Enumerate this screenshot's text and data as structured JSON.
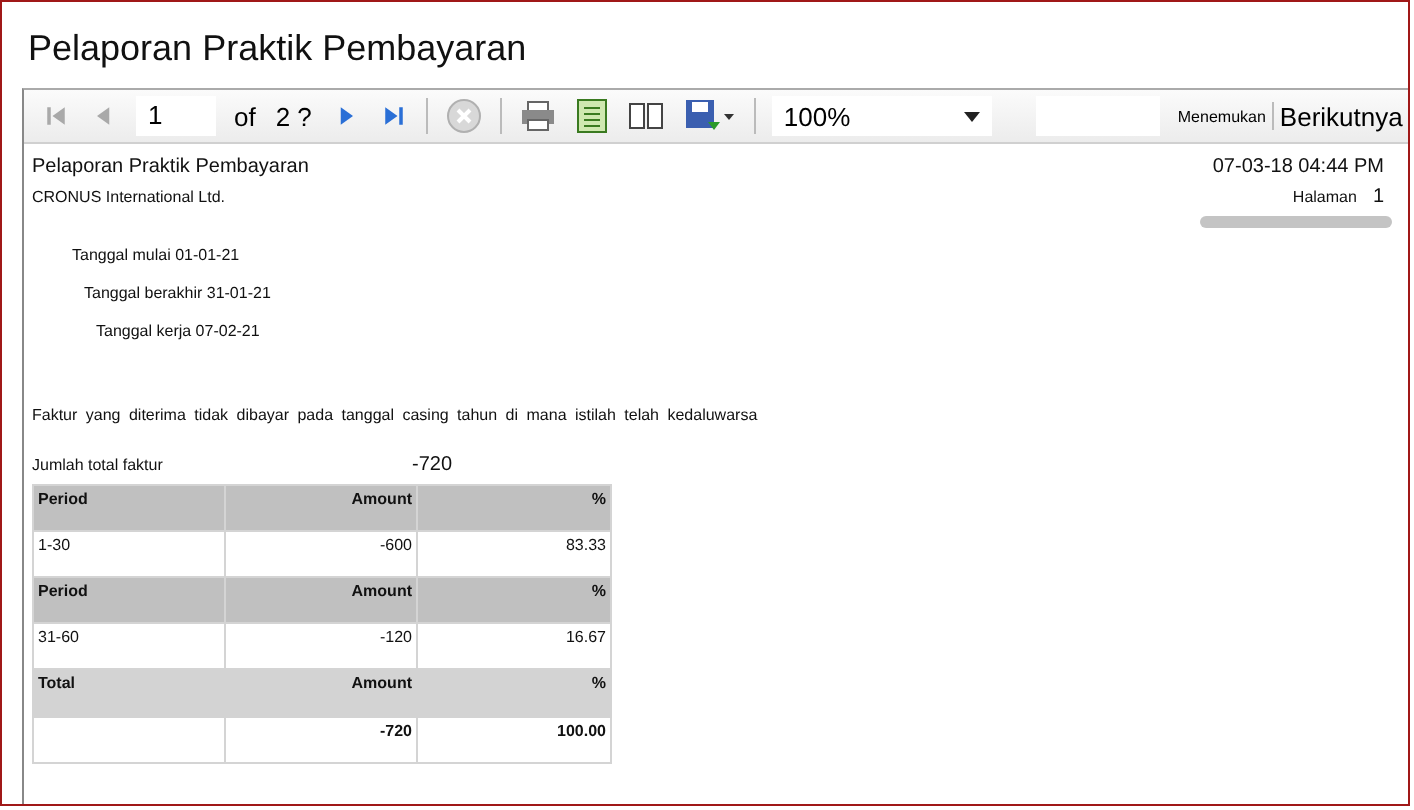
{
  "window": {
    "title": "Pelaporan Praktik Pembayaran"
  },
  "toolbar": {
    "nav_buttons": [
      {
        "kind": "first",
        "disabled": true
      },
      {
        "kind": "prev",
        "disabled": true
      }
    ],
    "page_value": "1",
    "of_label": "of",
    "page_count": "2 ?",
    "nav_buttons_after": [
      {
        "kind": "next",
        "disabled": false
      },
      {
        "kind": "last",
        "disabled": false
      }
    ],
    "stop_button": {
      "disabled": true
    },
    "tool_buttons": [
      {
        "kind": "print"
      },
      {
        "kind": "layout"
      },
      {
        "kind": "page_setup"
      },
      {
        "kind": "export"
      }
    ],
    "zoom": {
      "value": "100%"
    },
    "find_link": "Menemukan",
    "next_link": "Berikutnya"
  },
  "report": {
    "title": "Pelaporan Praktik Pembayaran",
    "company": "CRONUS International Ltd.",
    "timestamp": "07-03-18 04:44 PM",
    "page_label": "Halaman",
    "page_number": "1",
    "params": [
      "Tanggal mulai 01-01-21",
      "Tanggal berakhir 31-01-21",
      "Tanggal kerja 07-02-21"
    ],
    "description": "Faktur yang diterima tidak dibayar pada tanggal casing tahun di mana istilah telah kedaluwarsa",
    "total_label": "Jumlah total faktur",
    "total_value": "-720",
    "table": {
      "rows": [
        {
          "kind": "header",
          "cells": [
            "Period",
            "Amount",
            "%"
          ]
        },
        {
          "kind": "data",
          "cells": [
            "1-30",
            "-600",
            "83.33"
          ]
        },
        {
          "kind": "header",
          "cells": [
            "Period",
            "Amount",
            "%"
          ]
        },
        {
          "kind": "data",
          "cells": [
            "31-60",
            "-120",
            "16.67"
          ]
        },
        {
          "kind": "total_header",
          "cells": [
            "Total",
            "Amount",
            "%"
          ]
        },
        {
          "kind": "total_data",
          "cells": [
            "",
            "-720",
            "100.00"
          ]
        }
      ]
    }
  }
}
